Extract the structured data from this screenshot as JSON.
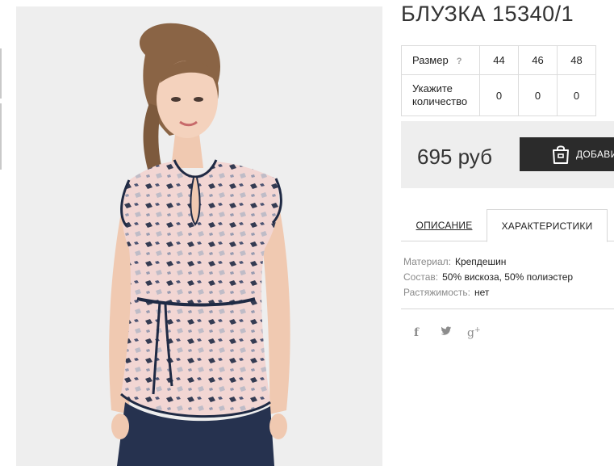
{
  "product": {
    "title": "БЛУЗКА 15340/1",
    "photo_alt": "",
    "sizes_label": "Размер",
    "sizes_help": "?",
    "sizes": [
      "44",
      "46",
      "48"
    ],
    "quantity_label": "Укажите количество",
    "quantities": [
      "0",
      "0",
      "0"
    ]
  },
  "price": {
    "value": "695 руб",
    "add_to_cart_label": "ДОБАВИ",
    "cart_icon": "shopping-bag-icon"
  },
  "tabs": [
    {
      "label": "ОПИСАНИЕ",
      "active": false
    },
    {
      "label": "ХАРАКТЕРИСТИКИ",
      "active": true
    }
  ],
  "specs": [
    {
      "key": "Материал:",
      "value": "Крепдешин"
    },
    {
      "key": "Состав:",
      "value": "50% вискоза, 50% полиэстер"
    },
    {
      "key": "Растяжимость:",
      "value": "нет"
    }
  ],
  "social": {
    "facebook": "f",
    "twitter_icon": "twitter-bird-icon",
    "googleplus": "g",
    "googleplus_sup": "+"
  },
  "colors": {
    "photo_bg": "#eeeeee",
    "price_box_bg": "#eeeeee",
    "cart_button_bg": "#2b2b2b",
    "blouse_pink": "#f2d6d3",
    "blouse_navy": "#1f2a44"
  }
}
